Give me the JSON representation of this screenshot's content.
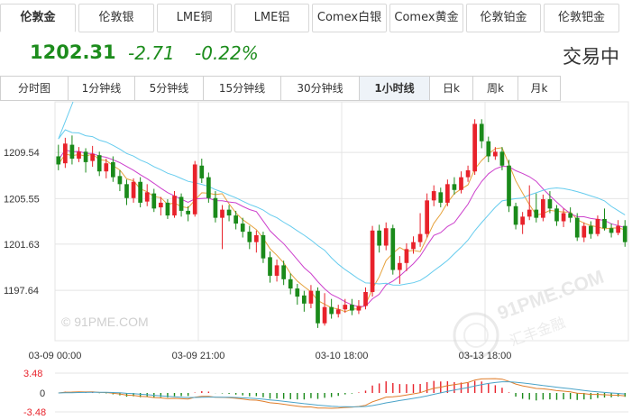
{
  "market_tabs": [
    "伦敦金",
    "伦敦银",
    "LME铜",
    "LME铝",
    "Comex白银",
    "Comex黄金",
    "伦敦铂金",
    "伦敦钯金"
  ],
  "active_market": 0,
  "quote": {
    "price": "1202.31",
    "change": "-2.71",
    "change_pct": "-0.22%",
    "status": "交易中"
  },
  "period_tabs": [
    "分时图",
    "1分钟线",
    "5分钟线",
    "15分钟线",
    "30分钟线",
    "1小时线",
    "日k",
    "周k",
    "月k"
  ],
  "active_period": 5,
  "watermark": "© 91PME.COM",
  "logo": {
    "domain": "91PME.COM",
    "tagline": "汇丰金融"
  },
  "colors": {
    "up": "#e8222b",
    "down": "#1a8a1a",
    "ma_short": "#e6a23c",
    "ma_mid": "#cc3fcc",
    "ma_long": "#66ccee",
    "macd_dif": "#e07d2a",
    "macd_dea": "#4aa3c8",
    "grid": "#e4e4e4"
  },
  "chart_data": {
    "type": "candlestick",
    "title": "",
    "xlabel": "",
    "ylabel": "",
    "y_ticks": [
      1209.54,
      1205.55,
      1201.63,
      1197.64
    ],
    "ylim": [
      1193.3,
      1213.9
    ],
    "x_ticks": [
      {
        "label": "03-09 00:00",
        "index": 0
      },
      {
        "label": "03-09 21:00",
        "index": 21
      },
      {
        "label": "03-10 18:00",
        "index": 42
      },
      {
        "label": "03-13 18:00",
        "index": 63
      }
    ],
    "candles": [
      [
        1209.2,
        1208.5,
        1210.2,
        1208.0
      ],
      [
        1208.6,
        1210.3,
        1210.8,
        1208.2
      ],
      [
        1210.2,
        1209.0,
        1211.0,
        1208.5
      ],
      [
        1209.0,
        1209.6,
        1210.0,
        1208.7
      ],
      [
        1209.6,
        1208.7,
        1209.9,
        1207.8
      ],
      [
        1208.8,
        1209.4,
        1210.1,
        1208.3
      ],
      [
        1209.3,
        1207.9,
        1209.6,
        1207.5
      ],
      [
        1207.9,
        1208.6,
        1209.0,
        1207.3
      ],
      [
        1208.7,
        1207.4,
        1209.2,
        1207.0
      ],
      [
        1207.5,
        1206.8,
        1208.0,
        1206.2
      ],
      [
        1206.8,
        1205.6,
        1207.2,
        1205.0
      ],
      [
        1205.6,
        1207.0,
        1207.3,
        1205.2
      ],
      [
        1207.0,
        1205.2,
        1207.4,
        1204.8
      ],
      [
        1205.3,
        1206.1,
        1206.8,
        1204.9
      ],
      [
        1206.0,
        1204.7,
        1206.4,
        1204.4
      ],
      [
        1204.8,
        1205.2,
        1205.7,
        1204.1
      ],
      [
        1205.2,
        1204.1,
        1205.5,
        1203.8
      ],
      [
        1204.1,
        1205.8,
        1206.2,
        1203.9
      ],
      [
        1205.7,
        1204.5,
        1206.0,
        1204.0
      ],
      [
        1204.5,
        1204.2,
        1204.9,
        1203.6
      ],
      [
        1204.2,
        1208.5,
        1208.8,
        1204.0
      ],
      [
        1208.4,
        1207.3,
        1209.0,
        1206.9
      ],
      [
        1207.4,
        1205.6,
        1207.8,
        1205.2
      ],
      [
        1205.6,
        1203.9,
        1206.2,
        1203.5
      ],
      [
        1203.9,
        1204.6,
        1205.0,
        1201.2
      ],
      [
        1204.6,
        1204.1,
        1205.0,
        1203.6
      ],
      [
        1204.1,
        1203.4,
        1204.5,
        1202.9
      ],
      [
        1203.4,
        1202.7,
        1203.9,
        1202.2
      ],
      [
        1202.7,
        1201.8,
        1203.2,
        1201.2
      ],
      [
        1201.8,
        1202.4,
        1202.8,
        1200.9
      ],
      [
        1202.4,
        1200.4,
        1202.7,
        1200.0
      ],
      [
        1200.5,
        1198.9,
        1201.0,
        1198.3
      ],
      [
        1198.9,
        1199.8,
        1200.3,
        1198.4
      ],
      [
        1199.8,
        1198.6,
        1200.2,
        1198.1
      ],
      [
        1198.6,
        1197.8,
        1199.1,
        1197.3
      ],
      [
        1197.8,
        1197.1,
        1198.2,
        1196.4
      ],
      [
        1197.2,
        1196.5,
        1197.6,
        1195.8
      ],
      [
        1196.5,
        1197.6,
        1198.1,
        1196.1
      ],
      [
        1197.6,
        1194.8,
        1197.9,
        1194.4
      ],
      [
        1194.8,
        1196.2,
        1197.4,
        1194.6
      ],
      [
        1196.2,
        1195.6,
        1196.9,
        1195.2
      ],
      [
        1195.6,
        1196.0,
        1196.4,
        1195.3
      ],
      [
        1196.0,
        1196.4,
        1196.9,
        1195.7
      ],
      [
        1196.4,
        1195.9,
        1196.9,
        1195.5
      ],
      [
        1195.9,
        1196.3,
        1196.8,
        1195.6
      ],
      [
        1196.3,
        1197.5,
        1197.9,
        1196.0
      ],
      [
        1197.5,
        1202.8,
        1203.2,
        1197.1
      ],
      [
        1202.8,
        1201.5,
        1203.3,
        1200.9
      ],
      [
        1201.5,
        1203.0,
        1203.5,
        1201.1
      ],
      [
        1203.0,
        1199.4,
        1203.3,
        1199.0
      ],
      [
        1199.4,
        1200.0,
        1200.6,
        1198.2
      ],
      [
        1200.0,
        1201.2,
        1201.7,
        1199.3
      ],
      [
        1201.2,
        1201.8,
        1202.3,
        1200.8
      ],
      [
        1201.8,
        1202.5,
        1204.3,
        1201.4
      ],
      [
        1202.5,
        1205.4,
        1206.0,
        1202.2
      ],
      [
        1205.4,
        1206.2,
        1206.7,
        1204.9
      ],
      [
        1206.1,
        1205.2,
        1206.5,
        1204.8
      ],
      [
        1205.2,
        1206.8,
        1207.2,
        1204.9
      ],
      [
        1206.8,
        1206.3,
        1207.4,
        1205.9
      ],
      [
        1206.3,
        1207.4,
        1207.9,
        1206.0
      ],
      [
        1207.4,
        1208.0,
        1208.4,
        1207.0
      ],
      [
        1207.9,
        1212.0,
        1212.4,
        1207.6
      ],
      [
        1212.0,
        1210.5,
        1212.4,
        1209.9
      ],
      [
        1210.5,
        1209.2,
        1210.9,
        1208.7
      ],
      [
        1209.2,
        1209.6,
        1210.0,
        1208.9
      ],
      [
        1209.6,
        1208.4,
        1210.0,
        1208.0
      ],
      [
        1208.4,
        1204.9,
        1208.9,
        1204.4
      ],
      [
        1204.9,
        1203.3,
        1205.2,
        1202.9
      ],
      [
        1203.3,
        1204.0,
        1204.4,
        1202.5
      ],
      [
        1204.0,
        1204.6,
        1206.7,
        1203.7
      ],
      [
        1204.6,
        1203.9,
        1206.0,
        1203.5
      ],
      [
        1203.9,
        1205.5,
        1205.9,
        1203.6
      ],
      [
        1205.5,
        1204.7,
        1206.2,
        1204.3
      ],
      [
        1204.7,
        1203.6,
        1205.0,
        1203.2
      ],
      [
        1203.6,
        1204.3,
        1204.7,
        1203.1
      ],
      [
        1204.3,
        1203.9,
        1204.8,
        1203.5
      ],
      [
        1203.9,
        1202.2,
        1204.3,
        1201.9
      ],
      [
        1202.2,
        1203.2,
        1203.5,
        1201.8
      ],
      [
        1203.2,
        1202.5,
        1203.6,
        1202.1
      ],
      [
        1202.5,
        1203.8,
        1204.1,
        1202.3
      ],
      [
        1203.8,
        1203.0,
        1204.7,
        1202.8
      ],
      [
        1203.0,
        1202.6,
        1203.4,
        1202.2
      ],
      [
        1202.6,
        1203.2,
        1203.7,
        1202.4
      ],
      [
        1203.2,
        1201.8,
        1203.7,
        1201.4
      ]
    ],
    "macd_axis": {
      "top_label": "3.48",
      "zero_label": "0",
      "bottom_label": "-3.48",
      "range": [
        -3.48,
        3.48
      ]
    }
  }
}
